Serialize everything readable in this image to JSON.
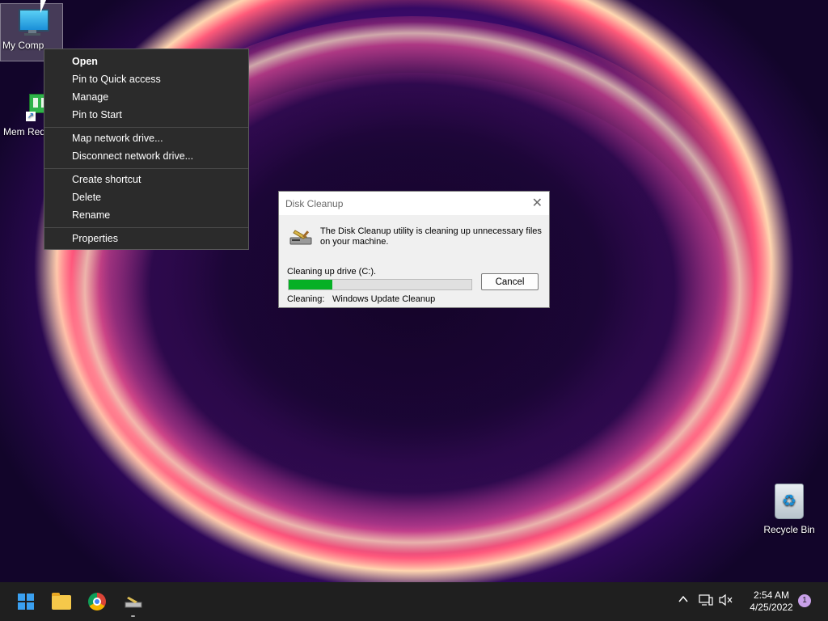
{
  "desktop": {
    "icons": [
      {
        "label": "My Comp"
      },
      {
        "label": "Mem Red"
      },
      {
        "label": "Recycle Bin"
      }
    ]
  },
  "context_menu": {
    "items": [
      {
        "label": "Open"
      },
      {
        "label": "Pin to Quick access"
      },
      {
        "label": "Manage"
      },
      {
        "label": "Pin to Start"
      },
      {
        "label": "Map network drive..."
      },
      {
        "label": "Disconnect network drive..."
      },
      {
        "label": "Create shortcut"
      },
      {
        "label": "Delete"
      },
      {
        "label": "Rename"
      },
      {
        "label": "Properties"
      }
    ]
  },
  "dialog": {
    "title": "Disk Cleanup",
    "message": "The Disk Cleanup utility is cleaning up unnecessary files on your machine.",
    "progress_label": "Cleaning up drive  (C:).",
    "progress_fraction": 0.24,
    "cancel_label": "Cancel",
    "cleaning_label": "Cleaning:",
    "cleaning_value": "Windows Update Cleanup"
  },
  "taskbar": {
    "apps": [
      "start-icon",
      "file-explorer-icon",
      "chrome-icon",
      "disk-cleanup-icon"
    ],
    "tray_icons": [
      "chevron-up-icon",
      "network-icon",
      "volume-muted-icon"
    ],
    "time": "2:54 AM",
    "date": "4/25/2022",
    "notification_count": "1"
  },
  "colors": {
    "progress_fill": "#06b025",
    "taskbar": "#1f1f1f",
    "menu_bg": "#2b2b2b"
  }
}
